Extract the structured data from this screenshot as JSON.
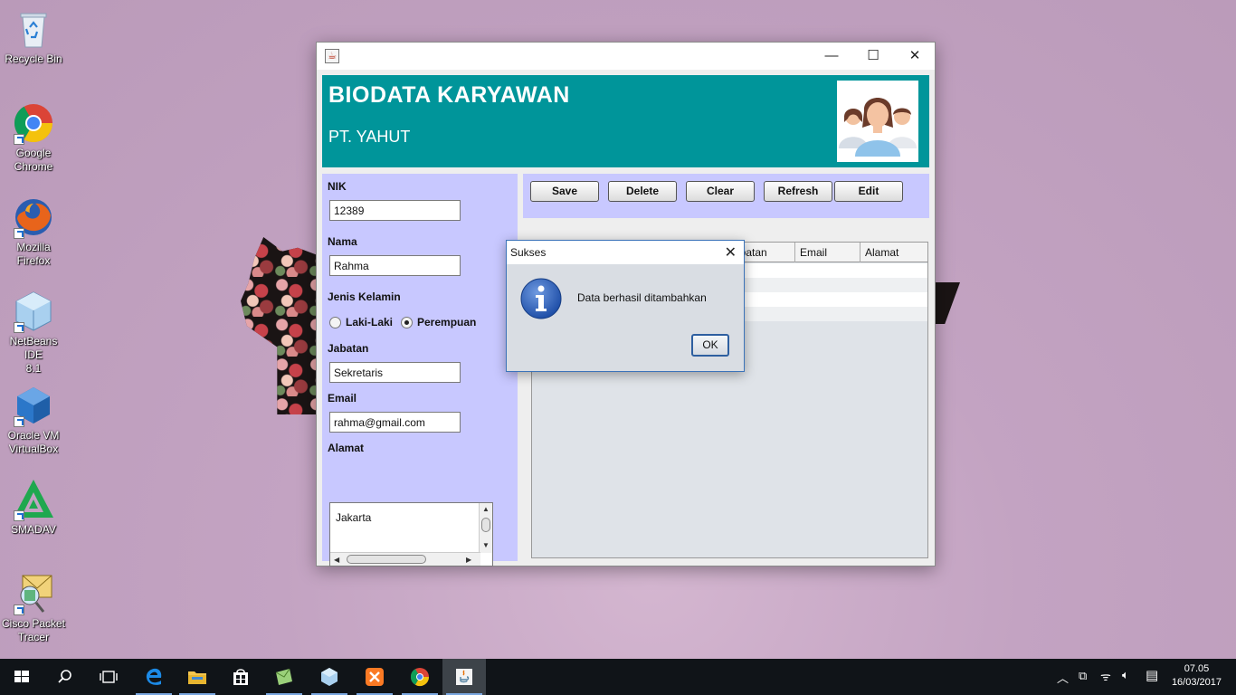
{
  "desktop": {
    "icons": [
      {
        "label": "Recycle Bin"
      },
      {
        "label": "Google\nChrome"
      },
      {
        "label": "Mozilla\nFirefox"
      },
      {
        "label": "NetBeans IDE\n8.1"
      },
      {
        "label": "Oracle VM\nVirtualBox"
      },
      {
        "label": "SMADAV"
      },
      {
        "label": "Cisco Packet\nTracer"
      }
    ]
  },
  "window": {
    "header": {
      "title": "BIODATA KARYAWAN",
      "subtitle": "PT. YAHUT"
    },
    "form": {
      "nik_label": "NIK",
      "nik_value": "12389",
      "nama_label": "Nama",
      "nama_value": "Rahma",
      "jenis_label": "Jenis Kelamin",
      "gender_options": [
        "Laki-Laki",
        "Perempuan"
      ],
      "gender_selected": "Perempuan",
      "jabatan_label": "Jabatan",
      "jabatan_value": "Sekretaris",
      "email_label": "Email",
      "email_value": "rahma@gmail.com",
      "alamat_label": "Alamat",
      "alamat_value": "Jakarta"
    },
    "toolbar": {
      "save": "Save",
      "delete": "Delete",
      "clear": "Clear",
      "refresh": "Refresh",
      "edit": "Edit"
    },
    "table": {
      "visible_headers": [
        "abatan",
        "Email",
        "Alamat"
      ]
    }
  },
  "dialog": {
    "title": "Sukses",
    "message": "Data berhasil ditambahkan",
    "ok": "OK"
  },
  "taskbar": {
    "time": "07.05",
    "date": "16/03/2017"
  },
  "colors": {
    "header_bg": "#00959a",
    "panel_bg": "#c8c8ff",
    "taskbar_bg": "#101418"
  }
}
